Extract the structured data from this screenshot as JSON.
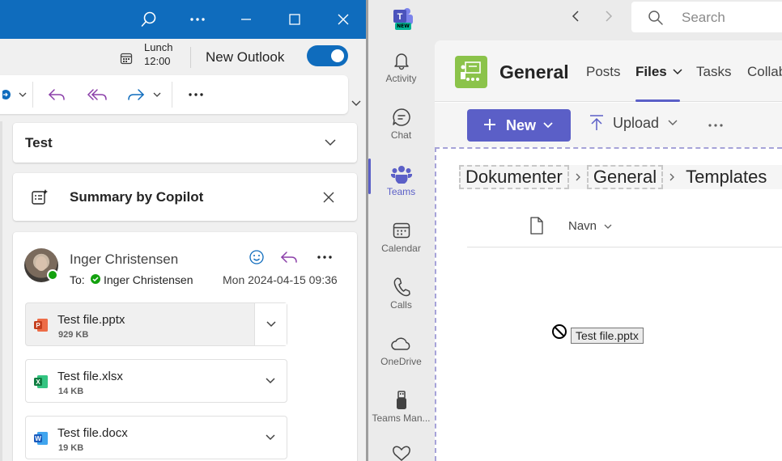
{
  "outlook": {
    "calendar_event": {
      "title": "Lunch",
      "time": "12:00"
    },
    "new_outlook_label": "New Outlook",
    "new_outlook_toggle": "on",
    "subject": "Test",
    "copilot_label": "Summary by Copilot",
    "message": {
      "sender": "Inger Christensen",
      "to_prefix": "To:",
      "recipient": "Inger Christensen",
      "date": "Mon 2024-04-15 09:36"
    },
    "attachments": [
      {
        "name": "Test file.pptx",
        "size": "929 KB",
        "type": "powerpoint"
      },
      {
        "name": "Test file.xlsx",
        "size": "14 KB",
        "type": "excel"
      },
      {
        "name": "Test file.docx",
        "size": "19 KB",
        "type": "word"
      }
    ]
  },
  "teams": {
    "badge": "NEW",
    "search_placeholder": "Search",
    "rail": [
      {
        "label": "Activity",
        "icon": "bell-icon"
      },
      {
        "label": "Chat",
        "icon": "chat-icon"
      },
      {
        "label": "Teams",
        "icon": "teams-icon",
        "active": true
      },
      {
        "label": "Calendar",
        "icon": "calendar-icon"
      },
      {
        "label": "Calls",
        "icon": "phone-icon"
      },
      {
        "label": "OneDrive",
        "icon": "cloud-icon"
      },
      {
        "label": "Teams Man...",
        "icon": "usb-icon"
      }
    ],
    "channel": {
      "name": "General",
      "tabs": [
        "Posts",
        "Files",
        "Tasks",
        "Collab"
      ],
      "active_tab": "Files"
    },
    "toolbar": {
      "new_label": "New",
      "upload_label": "Upload"
    },
    "breadcrumb": [
      "Dokumenter",
      "General",
      "Templates"
    ],
    "column_header": "Navn",
    "drag_tooltip": "Test file.pptx"
  },
  "colors": {
    "outlook_blue": "#0f6cbd",
    "teams_purple": "#5b5fc7"
  }
}
